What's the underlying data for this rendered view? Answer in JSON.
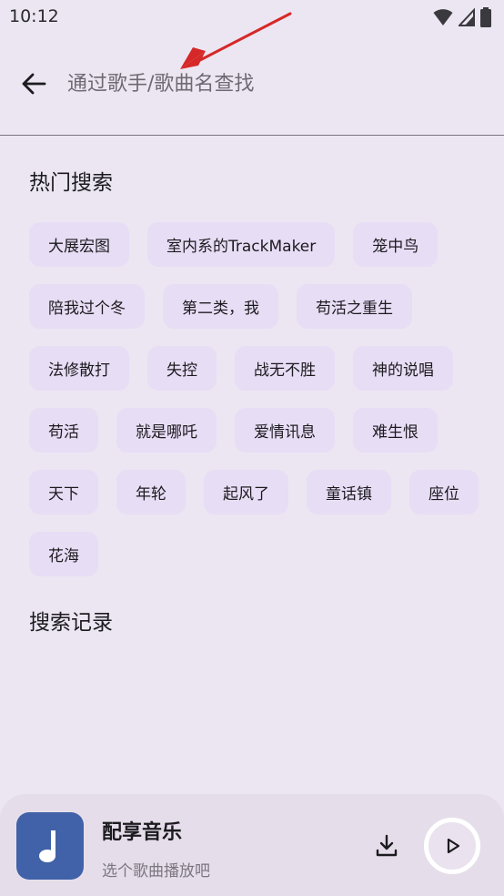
{
  "status_bar": {
    "time": "10:12",
    "icons": [
      "wifi-icon",
      "signal-icon",
      "battery-icon"
    ]
  },
  "search": {
    "placeholder": "通过歌手/歌曲名查找",
    "value": ""
  },
  "hot_search": {
    "title": "热门搜索",
    "chips": [
      "大展宏图",
      "室内系的TrackMaker",
      "笼中鸟",
      "陪我过个冬",
      "第二类，我",
      "苟活之重生",
      "法修散打",
      "失控",
      "战无不胜",
      "神的说唱",
      "苟活",
      "就是哪吒",
      "爱情讯息",
      "难生恨",
      "天下",
      "年轮",
      "起风了",
      "童话镇",
      "座位",
      "花海"
    ]
  },
  "history": {
    "title": "搜索记录"
  },
  "player": {
    "title": "配享音乐",
    "subtitle": "选个歌曲播放吧",
    "icons": [
      "music-note-icon",
      "download-icon",
      "play-icon"
    ]
  },
  "colors": {
    "background": "#ECE6F2",
    "chip": "#E7DDF5",
    "album_art": "#4162A8",
    "annotation_arrow": "#D62828"
  }
}
